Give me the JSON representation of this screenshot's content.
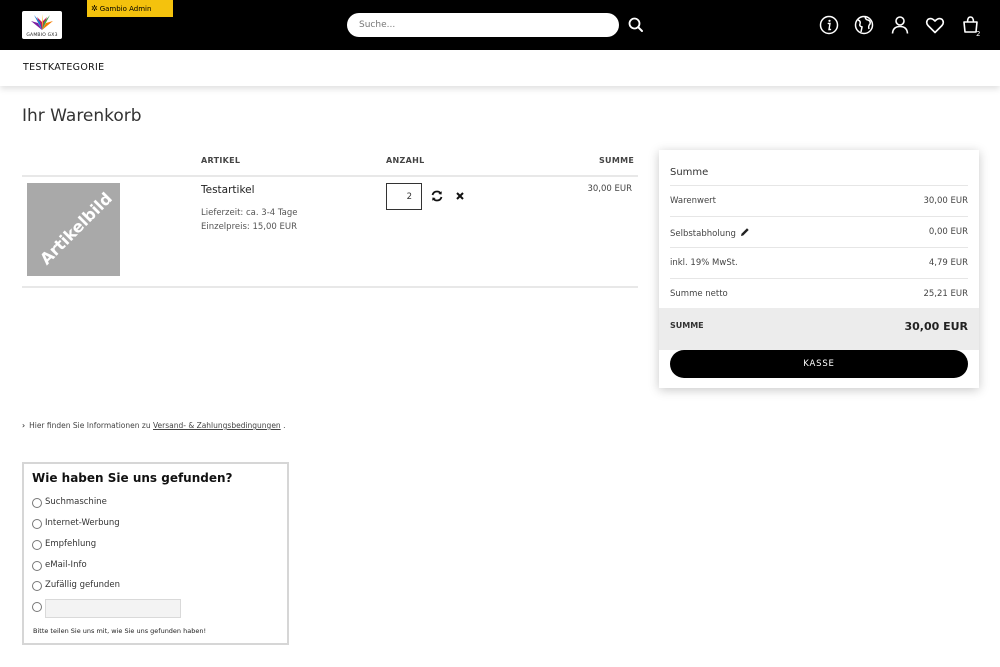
{
  "header": {
    "logo_text": "GAMBIO GX3",
    "admin_badge": "Gambio Admin",
    "search_placeholder": "Suche...",
    "cart_count": "2",
    "icons": [
      "info-icon",
      "globe-icon",
      "user-icon",
      "heart-icon",
      "cart-icon"
    ]
  },
  "nav": {
    "category": "TESTKATEGORIE"
  },
  "page": {
    "title": "Ihr Warenkorb"
  },
  "cart": {
    "columns": {
      "article": "ARTIKEL",
      "quantity": "ANZAHL",
      "sum": "SUMME"
    },
    "item": {
      "image_label": "Artikelbild",
      "name": "Testartikel",
      "delivery": "Lieferzeit: ca. 3-4 Tage",
      "unit_price": "Einzelpreis: 15,00 EUR",
      "quantity": "2",
      "line_total": "30,00 EUR"
    }
  },
  "summary": {
    "title": "Summe",
    "rows": [
      {
        "label": "Warenwert",
        "value": "30,00 EUR"
      },
      {
        "label": "Selbstabholung",
        "value": "0,00 EUR"
      },
      {
        "label": "inkl. 19% MwSt.",
        "value": "4,79 EUR"
      },
      {
        "label": "Summe netto",
        "value": "25,21 EUR"
      }
    ],
    "total_label": "SUMME",
    "total_value": "30,00 EUR",
    "checkout_label": "KASSE"
  },
  "info": {
    "prefix": "Hier finden Sie Informationen zu",
    "link": "Versand- & Zahlungsbedingungen",
    "suffix": "."
  },
  "survey": {
    "title": "Wie haben Sie uns gefunden?",
    "options": [
      "Suchmaschine",
      "Internet-Werbung",
      "Empfehlung",
      "eMail-Info",
      "Zufällig gefunden"
    ],
    "note": "Bitte teilen Sie uns mit, wie Sie uns gefunden haben!"
  },
  "colors": {
    "topbar": "#000000",
    "admin_badge": "#f4c20d",
    "button": "#000000",
    "total_band": "#ececec"
  }
}
